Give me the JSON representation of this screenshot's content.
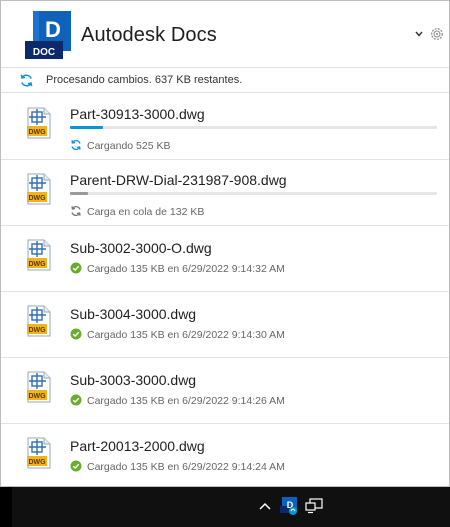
{
  "header": {
    "logo_letter": "D",
    "logo_text": "DOC",
    "title": "Autodesk Docs",
    "menu_icon": "chevron-down-icon",
    "settings_icon": "gear-icon"
  },
  "status": {
    "icon": "sync-icon",
    "text": "Procesando cambios. 637 KB restantes."
  },
  "files": [
    {
      "name": "Part-30913-3000.dwg",
      "state": "uploading",
      "status": "Cargando 525 KB",
      "progress": 0.09,
      "icon_label": "DWG"
    },
    {
      "name": "Parent-DRW-Dial-231987-908.dwg",
      "state": "queued",
      "status": "Carga en cola de 132 KB",
      "progress": 0.05,
      "icon_label": "DWG"
    },
    {
      "name": "Sub-3002-3000-O.dwg",
      "state": "done",
      "status": "Cargado 135 KB en 6/29/2022 9:14:32 AM",
      "icon_label": "DWG"
    },
    {
      "name": "Sub-3004-3000.dwg",
      "state": "done",
      "status": "Cargado 135 KB en 6/29/2022 9:14:30 AM",
      "icon_label": "DWG"
    },
    {
      "name": "Sub-3003-3000.dwg",
      "state": "done",
      "status": "Cargado 135 KB en 6/29/2022 9:14:26 AM",
      "icon_label": "DWG"
    },
    {
      "name": "Part-20013-2000.dwg",
      "state": "done",
      "status": "Cargado 135 KB en 6/29/2022 9:14:24 AM",
      "icon_label": "DWG"
    }
  ],
  "colors": {
    "accent": "#0696d7",
    "logo_blue": "#0f62b8",
    "logo_dark": "#0b2a6b",
    "success": "#6aad2c",
    "queued_bar": "#9a9a9a",
    "dwg_yellow": "#f2b21c",
    "dwg_blue": "#2e6fb7"
  },
  "taskbar": {
    "icons": [
      "chevron-up-icon",
      "autodesk-docs-tray-icon",
      "network-icon"
    ]
  }
}
